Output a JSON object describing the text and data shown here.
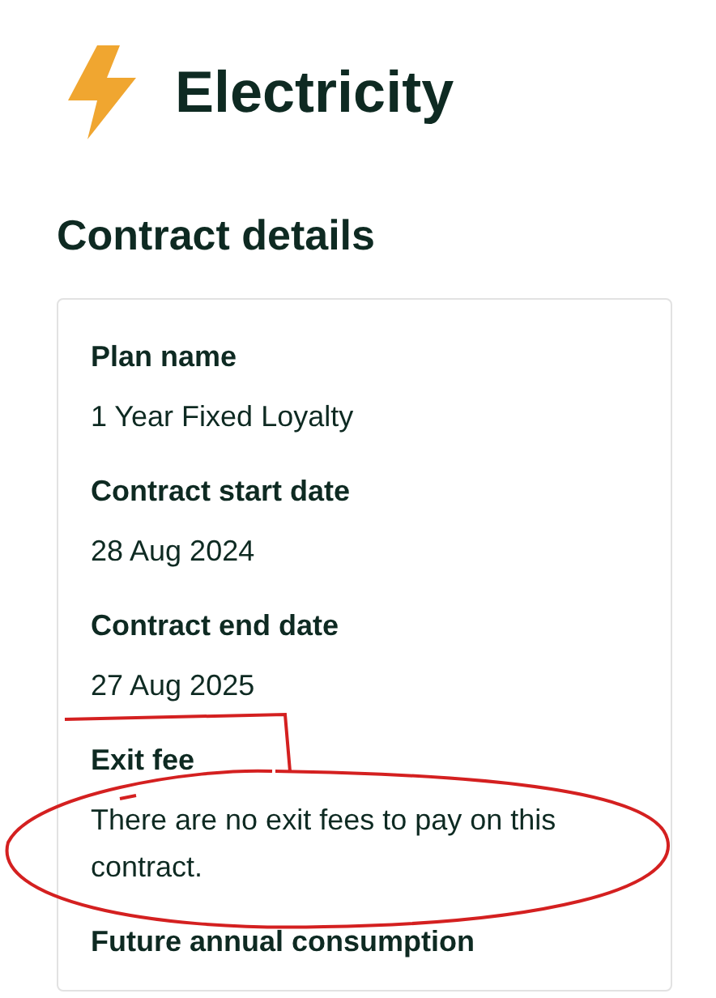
{
  "title": "Electricity",
  "section": {
    "heading": "Contract details",
    "fields": [
      {
        "label": "Plan name",
        "value": "1 Year Fixed Loyalty"
      },
      {
        "label": "Contract start date",
        "value": "28 Aug 2024"
      },
      {
        "label": "Contract end date",
        "value": "27 Aug 2025"
      },
      {
        "label": "Exit fee",
        "value": "There are no exit fees to pay on this contract."
      },
      {
        "label": "Future annual consumption"
      }
    ]
  }
}
